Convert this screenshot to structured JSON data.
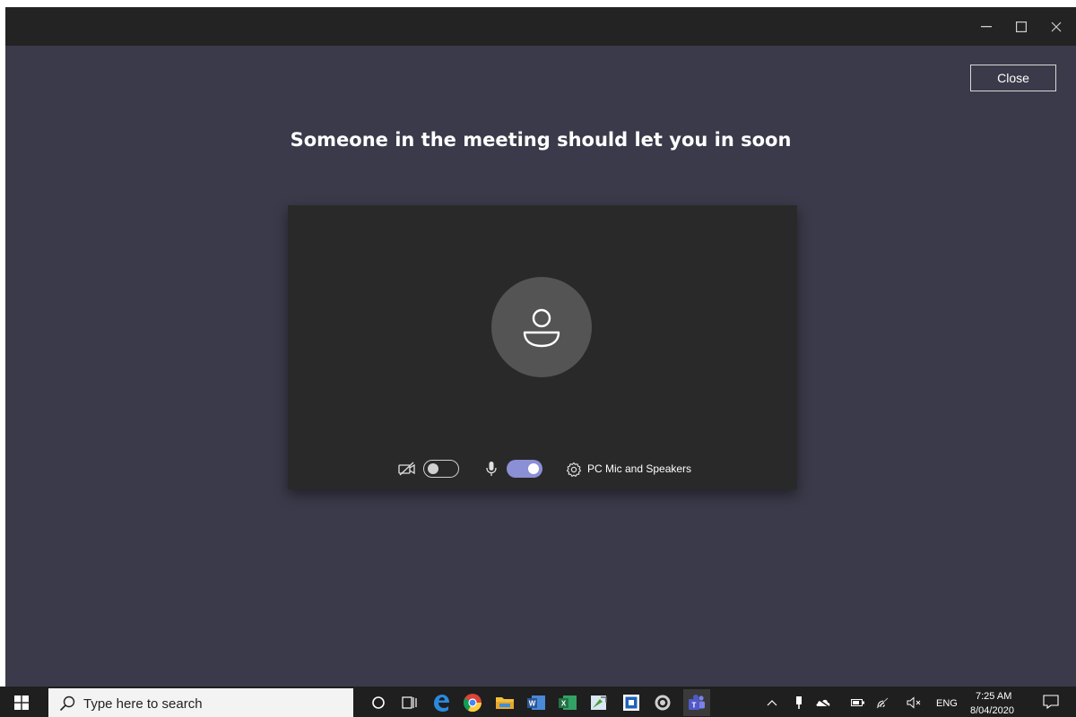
{
  "window": {
    "controls": [
      "minimize-icon",
      "maximize-icon",
      "close-icon"
    ],
    "close_label": "Close"
  },
  "lobby": {
    "message": "Someone in the meeting should let you in soon",
    "camera_on": false,
    "mic_on": true,
    "device_label": "PC Mic and Speakers"
  },
  "taskbar": {
    "search_placeholder": "Type here to search",
    "pinned_apps": [
      "cortana-icon",
      "task-view-icon",
      "edge-icon",
      "chrome-icon",
      "file-explorer-icon",
      "word-icon",
      "excel-icon",
      "paint-icon",
      "sandbox-icon",
      "app-icon",
      "teams-icon"
    ],
    "tray": [
      "chevron-up-icon",
      "usb-icon",
      "onedrive-icon",
      "battery-icon",
      "wifi-icon",
      "volume-muted-icon"
    ],
    "language": "ENG",
    "time": "7:25 AM",
    "date": "8/04/2020"
  },
  "colors": {
    "background": "#3b3a4a",
    "titlebar": "#232323",
    "preview": "#292929",
    "accent": "#8b8fd6",
    "taskbar": "#1f1f1f"
  }
}
